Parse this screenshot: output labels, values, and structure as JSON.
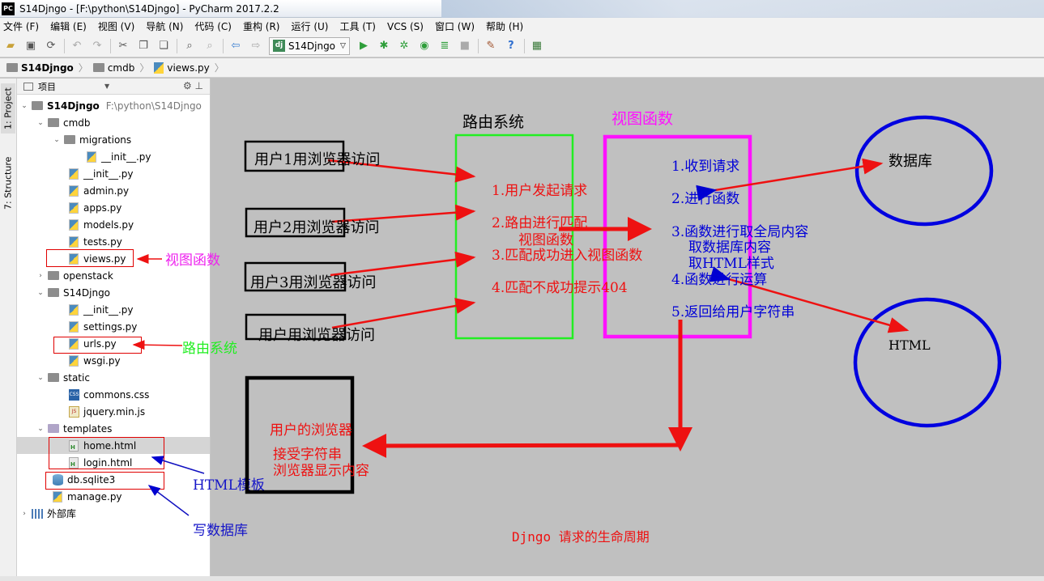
{
  "window": {
    "title": "S14Djngo - [F:\\python\\S14Djngo] - PyCharm 2017.2.2",
    "logo": "PC"
  },
  "menu": [
    "文件 (F)",
    "编辑 (E)",
    "视图 (V)",
    "导航 (N)",
    "代码 (C)",
    "重构 (R)",
    "运行 (U)",
    "工具 (T)",
    "VCS (S)",
    "窗口 (W)",
    "帮助 (H)"
  ],
  "toolbar": {
    "run_config": "S14Djngo",
    "run_config_badge": "dj"
  },
  "breadcrumb": [
    "S14Djngo",
    "cmdb",
    "views.py"
  ],
  "toolstrip": {
    "project_tab": "1: Project",
    "structure_tab": "7: Structure"
  },
  "panel": {
    "header": "项目"
  },
  "tree": {
    "root": "S14Djngo",
    "root_path": "F:\\python\\S14Djngo",
    "cmdb": "cmdb",
    "migrations": "migrations",
    "mig_init": "__init__.py",
    "cmdb_init": "__init__.py",
    "admin": "admin.py",
    "apps": "apps.py",
    "models": "models.py",
    "tests": "tests.py",
    "views": "views.py",
    "openstack": "openstack",
    "s14": "S14Djngo",
    "s14_init": "__init__.py",
    "settings": "settings.py",
    "urls": "urls.py",
    "wsgi": "wsgi.py",
    "static": "static",
    "commons": "commons.css",
    "jquery": "jquery.min.js",
    "templates": "templates",
    "home": "home.html",
    "login": "login.html",
    "db": "db.sqlite3",
    "manage": "manage.py",
    "ext": "外部库",
    "css_badge": "CSS",
    "js_badge": "JS"
  },
  "annotations": {
    "views_label": "视图函数",
    "urls_label": "路由系统",
    "html_label": "HTML模板",
    "db_label": "写数据库"
  },
  "diagram": {
    "user1": "用户1用浏览器访问",
    "user2": "用户2用浏览器访问",
    "user3": "用户3用浏览器访问",
    "user4": "用户用浏览器访问",
    "router_title": "路由系统",
    "router_steps": [
      "1.用户发起请求",
      "2.路由进行匹配",
      "3.匹配成功进入视图函数",
      "4.匹配不成功提示404"
    ],
    "router_note": "视图函数",
    "view_title": "视图函数",
    "view_steps": [
      "1.收到请求",
      "2.进行函数",
      "3.函数进行取全局内容",
      "取数据库内容",
      "取HTML样式",
      "4.函数进行运算",
      "5.返回给用户字符串"
    ],
    "db": "数据库",
    "html": "HTML",
    "browser_lines": [
      "用户的浏览器",
      "接受字符串",
      "浏览器显示内容"
    ],
    "caption": "Djngo 请求的生命周期"
  },
  "colors": {
    "red": "#ee1111",
    "blue": "#0000e0",
    "green": "#22ee22",
    "magenta": "#ff11ff",
    "canvas": "#c0c0c0"
  }
}
